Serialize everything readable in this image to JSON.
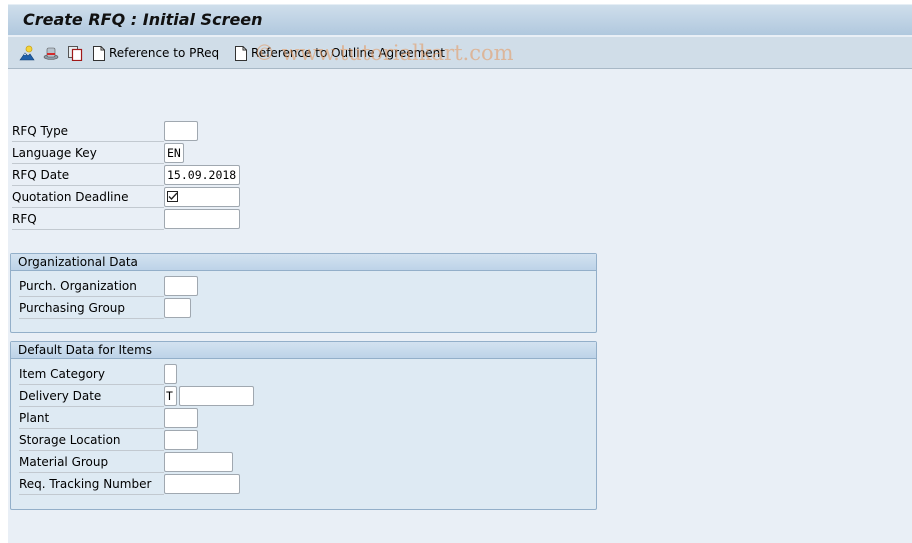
{
  "window": {
    "title": "Create RFQ : Initial Screen"
  },
  "toolbar": {
    "icons": [
      {
        "name": "person-mountain-icon",
        "tooltip": ""
      },
      {
        "name": "hat-icon",
        "tooltip": ""
      },
      {
        "name": "copy-icon",
        "tooltip": ""
      }
    ],
    "buttons": [
      {
        "label": "Reference to PReq",
        "icon": "document-icon"
      },
      {
        "label": "Reference to Outline Agreement",
        "icon": "document-icon"
      }
    ],
    "watermark": "© www.tutorialkart.com"
  },
  "header_fields": [
    {
      "label": "RFQ Type",
      "value": ""
    },
    {
      "label": "Language Key",
      "value": "EN"
    },
    {
      "label": "RFQ Date",
      "value": "15.09.2018"
    },
    {
      "label": "Quotation Deadline",
      "value": "",
      "icon": "checkbox-icon"
    },
    {
      "label": "RFQ",
      "value": ""
    }
  ],
  "org_data": {
    "title": "Organizational Data",
    "fields": [
      {
        "label": "Purch. Organization",
        "value": ""
      },
      {
        "label": "Purchasing Group",
        "value": ""
      }
    ]
  },
  "default_items": {
    "title": "Default Data for Items",
    "fields": [
      {
        "label": "Item Category",
        "value": ""
      },
      {
        "label": "Delivery Date",
        "prefix": "T",
        "value": ""
      },
      {
        "label": "Plant",
        "value": ""
      },
      {
        "label": "Storage Location",
        "value": ""
      },
      {
        "label": "Material Group",
        "value": ""
      },
      {
        "label": "Req. Tracking Number",
        "value": ""
      }
    ]
  }
}
